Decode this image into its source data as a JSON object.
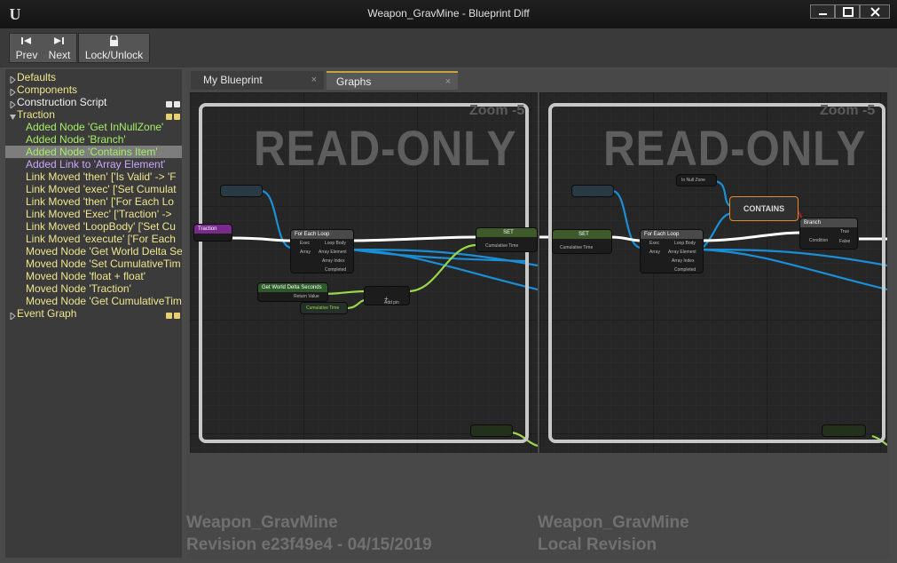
{
  "window": {
    "title": "Weapon_GravMine - Blueprint Diff",
    "logo": "U",
    "controls": [
      "minimize-icon",
      "maximize-icon",
      "close-icon"
    ]
  },
  "toolbar": {
    "prev_label": "Prev",
    "next_label": "Next",
    "lock_label": "Lock/Unlock"
  },
  "tree": {
    "items": [
      {
        "label": "Defaults",
        "kind": "category",
        "color": "#f0e68c"
      },
      {
        "label": "Components",
        "kind": "category",
        "color": "#f0e68c"
      },
      {
        "label": "Construction Script",
        "kind": "category",
        "color": "#f2f2f2",
        "badge": "white"
      },
      {
        "label": "Traction",
        "kind": "category-expanded",
        "color": "#f0e68c",
        "badge": "yellow"
      },
      {
        "label": "Added Node 'Get InNullZone'",
        "kind": "change",
        "color": "#a6ee66"
      },
      {
        "label": "Added Node 'Branch'",
        "kind": "change",
        "color": "#a6ee66"
      },
      {
        "label": "Added Node 'Contains Item'",
        "kind": "change",
        "color": "#a6ee66",
        "selected": true
      },
      {
        "label": "Added Link to 'Array Element'",
        "kind": "change",
        "color": "#c9a6ff"
      },
      {
        "label": "Link Moved  'then' ['Is Valid' -> 'F",
        "kind": "change",
        "color": "#f0e68c"
      },
      {
        "label": "Link Moved  'exec' ['Set Cumulat",
        "kind": "change",
        "color": "#f0e68c"
      },
      {
        "label": "Link Moved  'then' ['For Each Lo",
        "kind": "change",
        "color": "#f0e68c"
      },
      {
        "label": "Link Moved  'Exec' ['Traction' ->",
        "kind": "change",
        "color": "#f0e68c"
      },
      {
        "label": "Link Moved  'LoopBody' ['Set Cu",
        "kind": "change",
        "color": "#f0e68c"
      },
      {
        "label": "Link Moved  'execute' ['For Each",
        "kind": "change",
        "color": "#f0e68c"
      },
      {
        "label": "Moved Node 'Get World Delta Sec",
        "kind": "change",
        "color": "#f0e68c"
      },
      {
        "label": "Moved Node 'Set CumulativeTim",
        "kind": "change",
        "color": "#f0e68c"
      },
      {
        "label": "Moved Node 'float + float'",
        "kind": "change",
        "color": "#f0e68c"
      },
      {
        "label": "Moved Node 'Traction'",
        "kind": "change",
        "color": "#f0e68c"
      },
      {
        "label": "Moved Node 'Get CumulativeTim",
        "kind": "change",
        "color": "#f0e68c"
      },
      {
        "label": "Event Graph",
        "kind": "category",
        "color": "#f0e68c",
        "badge": "yellow"
      }
    ]
  },
  "tabs": [
    {
      "label": "My Blueprint",
      "close": "×",
      "active": false
    },
    {
      "label": "Graphs",
      "close": "×",
      "active": true
    }
  ],
  "graphs": {
    "left": {
      "watermark": "READ-ONLY",
      "zoom": "Zoom -5",
      "asset": "Weapon_GravMine",
      "revision": "Revision e23f49e4 - 04/15/2019",
      "nodes": {
        "traction": "Traction",
        "foreach": "For Each Loop",
        "foreach_pins": [
          "Exec",
          "Array",
          "Loop Body",
          "Array Element",
          "Array Index",
          "Completed"
        ],
        "set": "SET",
        "set_pin": "Cumulative Time",
        "world_delta": "Get World Delta Seconds",
        "return_value": "Return Value",
        "cumulative": "Cumulative Time",
        "add_pin": "Add pin"
      }
    },
    "right": {
      "watermark": "READ-ONLY",
      "zoom": "Zoom -5",
      "asset": "Weapon_GravMine",
      "revision": "Local Revision",
      "nodes": {
        "set": "SET",
        "set_pin": "Cumulative Time",
        "in_null_zone": "In Null Zone",
        "contains": "CONTAINS",
        "foreach": "For Each Loop",
        "foreach_pins": [
          "Exec",
          "Array",
          "Loop Body",
          "Array Element",
          "Array Index",
          "Completed"
        ],
        "branch": "Branch",
        "branch_pins": [
          "Condition",
          "True",
          "False"
        ]
      }
    }
  },
  "colors": {
    "exec_wire": "#ffffff",
    "array_wire": "#1a8fd6",
    "float_wire": "#9ad84a",
    "selection_bg": "#7d7d7d",
    "contains_border": "#e08c2c"
  }
}
